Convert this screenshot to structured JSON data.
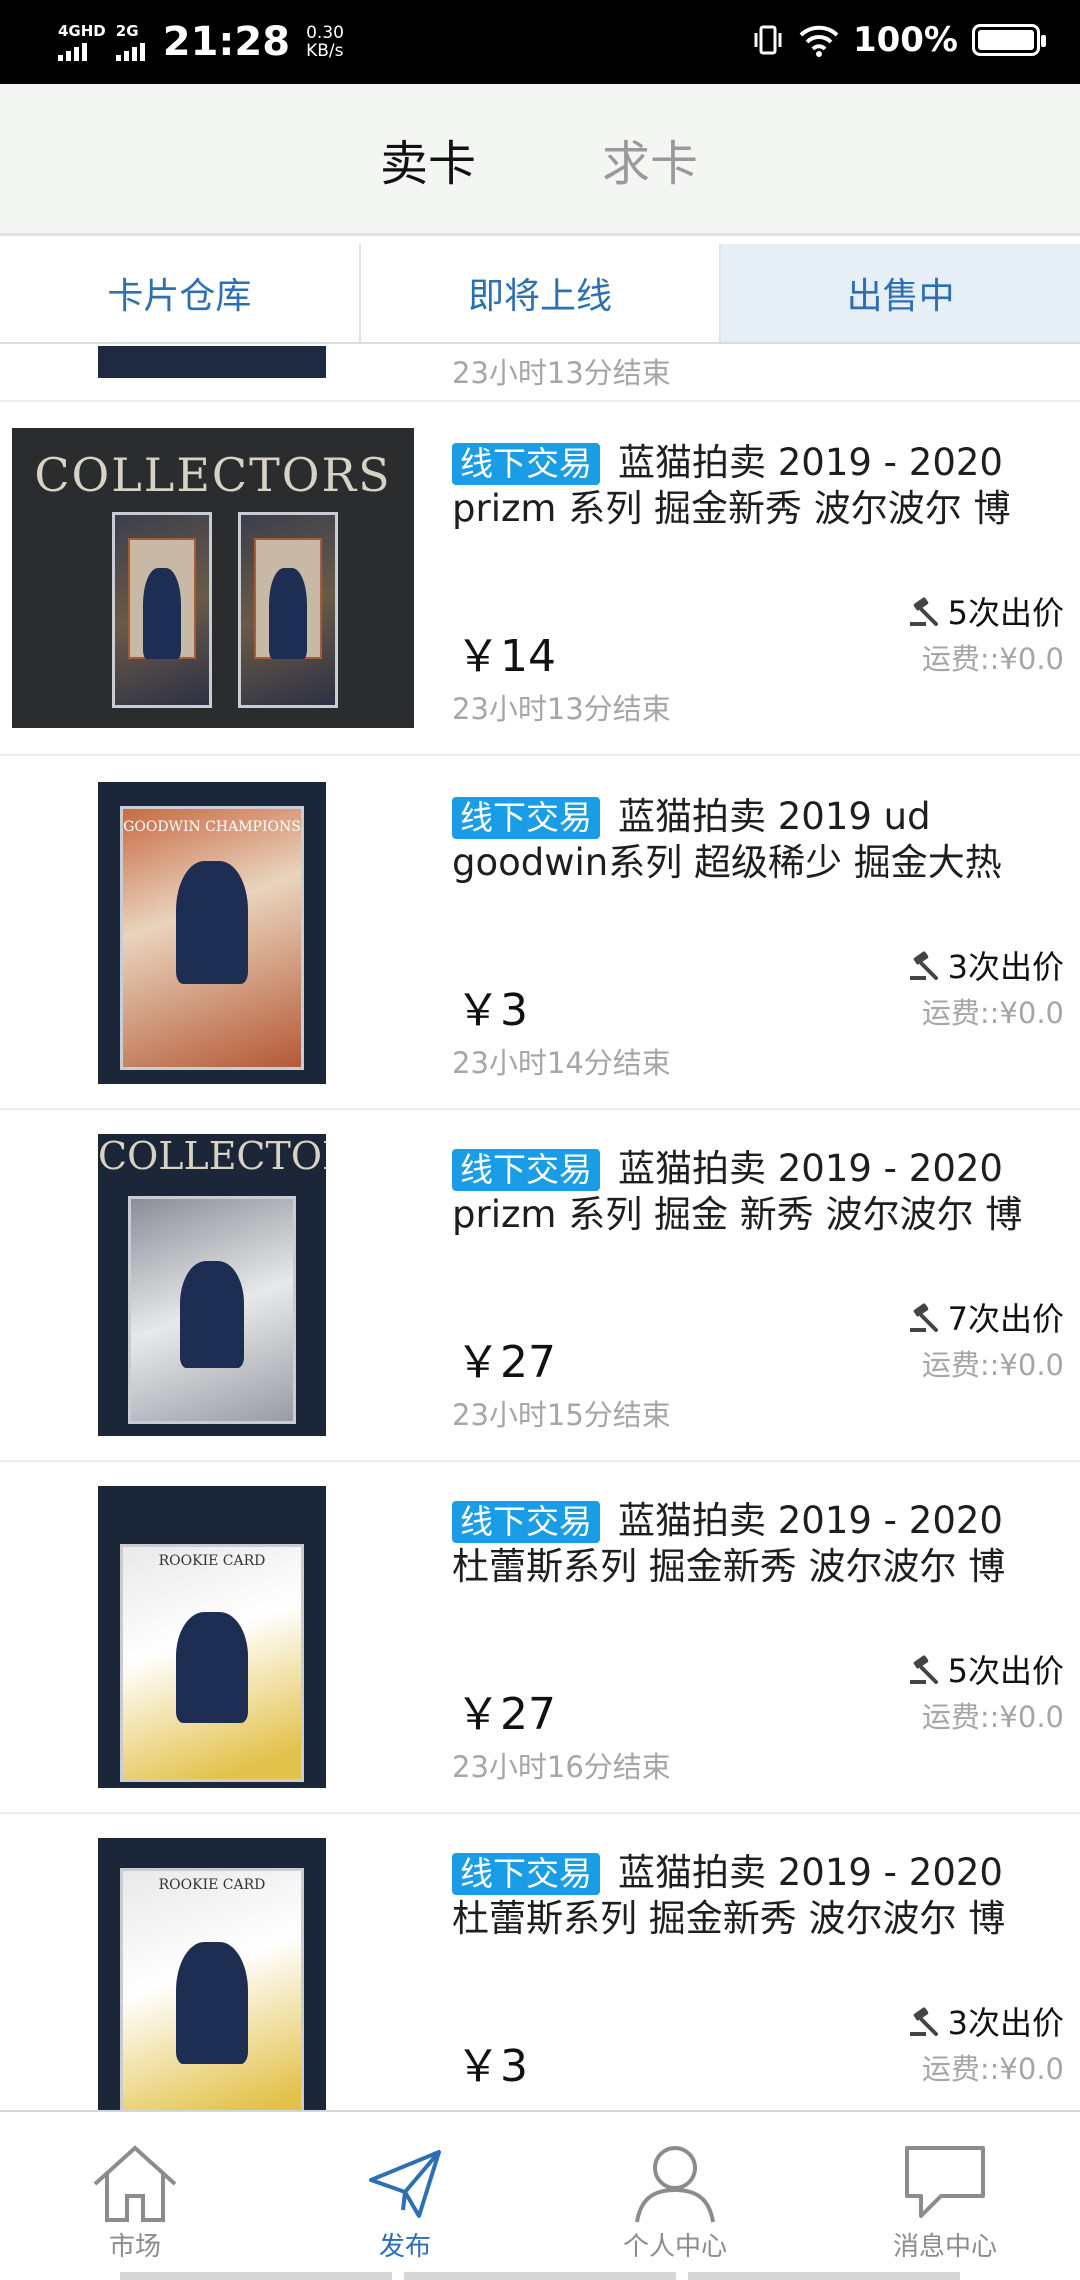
{
  "status_bar": {
    "sim1_label": "4GHD",
    "sim2_label": "2G",
    "time": "21:28",
    "net_speed_value": "0.30",
    "net_speed_unit": "KB/s",
    "battery_percent": "100%"
  },
  "header": {
    "tabs": [
      {
        "label": "卖卡",
        "active": true
      },
      {
        "label": "求卡",
        "active": false
      }
    ]
  },
  "subtabs": [
    {
      "label": "卡片仓库",
      "active": false
    },
    {
      "label": "即将上线",
      "active": false
    },
    {
      "label": "出售中",
      "active": true
    }
  ],
  "partial_item": {
    "end_time": "23小时13分结束"
  },
  "listings": [
    {
      "tag": "线下交易",
      "title_line1": "蓝猫拍卖 2019 - 2020",
      "title_line2": "prizm 系列 掘金新秀 波尔波尔 博",
      "price": "￥14",
      "end_time": "23小时13分结束",
      "bids": "5次出价",
      "shipping": "运费::¥0.0",
      "image_text": "COLLECTORS"
    },
    {
      "tag": "线下交易",
      "title_line1": "蓝猫拍卖 2019 ud",
      "title_line2": "goodwin系列 超级稀少 掘金大热",
      "price": "￥3",
      "end_time": "23小时14分结束",
      "bids": "3次出价",
      "shipping": "运费::¥0.0",
      "image_text": "GOODWIN CHAMPIONS"
    },
    {
      "tag": "线下交易",
      "title_line1": "蓝猫拍卖 2019 - 2020",
      "title_line2": "prizm 系列 掘金 新秀 波尔波尔 博",
      "price": "￥27",
      "end_time": "23小时15分结束",
      "bids": "7次出价",
      "shipping": "运费::¥0.0",
      "image_text": "COLLECTOR"
    },
    {
      "tag": "线下交易",
      "title_line1": "蓝猫拍卖 2019 - 2020",
      "title_line2": "杜蕾斯系列 掘金新秀 波尔波尔 博",
      "price": "￥27",
      "end_time": "23小时16分结束",
      "bids": "5次出价",
      "shipping": "运费::¥0.0",
      "image_text": "ROOKIE CARD"
    },
    {
      "tag": "线下交易",
      "title_line1": "蓝猫拍卖 2019 - 2020",
      "title_line2": "杜蕾斯系列 掘金新秀 波尔波尔 博",
      "price": "￥3",
      "end_time": "",
      "bids": "3次出价",
      "shipping": "运费::¥0.0",
      "image_text": "ROOKIE CARD"
    }
  ],
  "bottom_nav": [
    {
      "label": "市场",
      "icon": "home-icon",
      "active": false
    },
    {
      "label": "发布",
      "icon": "send-icon",
      "active": true
    },
    {
      "label": "个人中心",
      "icon": "person-icon",
      "active": false
    },
    {
      "label": "消息中心",
      "icon": "chat-icon",
      "active": false
    }
  ],
  "colors": {
    "accent_blue": "#2d6fb3",
    "tag_blue": "#1b9de6",
    "muted_gray": "#a6a6a6"
  }
}
